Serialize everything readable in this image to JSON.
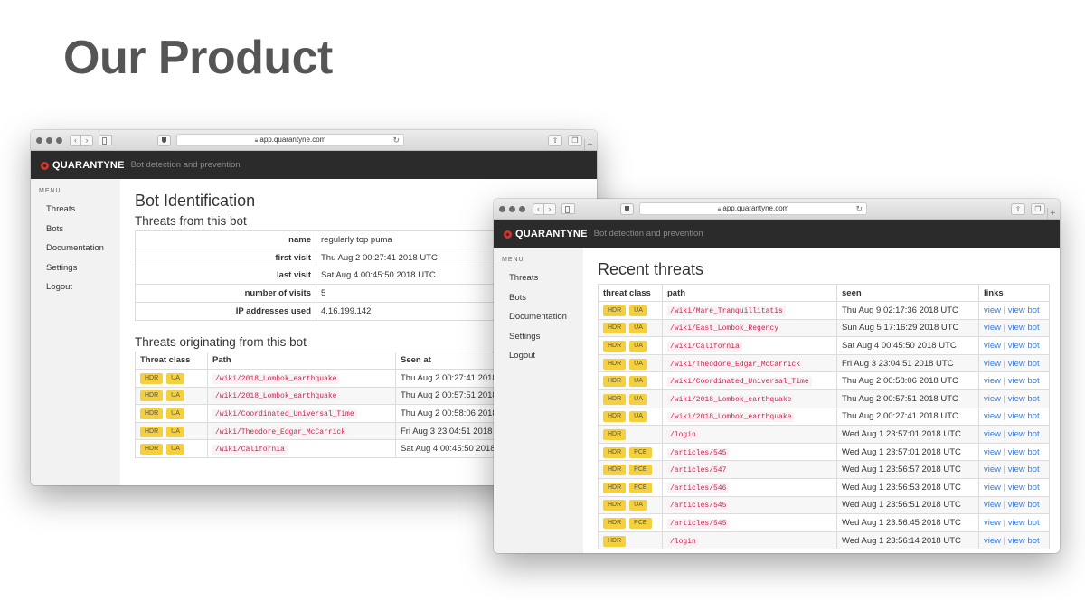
{
  "slide": {
    "title": "Our Product"
  },
  "browser": {
    "url": "app.quarantyne.com",
    "new_tab_symbol": "+"
  },
  "app": {
    "brand": "QUARANTYNE",
    "tagline": "Bot detection and prevention"
  },
  "menu": {
    "heading": "MENU",
    "items": [
      "Threats",
      "Bots",
      "Documentation",
      "Settings",
      "Logout"
    ]
  },
  "bot_page": {
    "title": "Bot Identification",
    "subtitle": "Threats from this bot",
    "fields": [
      {
        "label": "name",
        "value": "regularly top puma"
      },
      {
        "label": "first visit",
        "value": "Thu Aug 2 00:27:41 2018 UTC"
      },
      {
        "label": "last visit",
        "value": "Sat Aug 4 00:45:50 2018 UTC"
      },
      {
        "label": "number of visits",
        "value": "5"
      },
      {
        "label": "IP addresses used",
        "value": "4.16.199.142"
      }
    ],
    "threats_title": "Threats originating from this bot",
    "columns": [
      "Threat class",
      "Path",
      "Seen at"
    ],
    "rows": [
      {
        "badges": [
          "HDR",
          "UA"
        ],
        "path": "/wiki/2018_Lombok_earthquake",
        "seen": "Thu Aug 2 00:27:41 2018 UTC"
      },
      {
        "badges": [
          "HDR",
          "UA"
        ],
        "path": "/wiki/2018_Lombok_earthquake",
        "seen": "Thu Aug 2 00:57:51 2018 UTC"
      },
      {
        "badges": [
          "HDR",
          "UA"
        ],
        "path": "/wiki/Coordinated_Universal_Time",
        "seen": "Thu Aug 2 00:58:06 2018 UTC"
      },
      {
        "badges": [
          "HDR",
          "UA"
        ],
        "path": "/wiki/Theodore_Edgar_McCarrick",
        "seen": "Fri Aug 3 23:04:51 2018 UTC"
      },
      {
        "badges": [
          "HDR",
          "UA"
        ],
        "path": "/wiki/California",
        "seen": "Sat Aug 4 00:45:50 2018 UTC"
      }
    ]
  },
  "recent_page": {
    "title": "Recent threats",
    "columns": [
      "threat class",
      "path",
      "seen",
      "links"
    ],
    "link_view": "view",
    "link_sep": "|",
    "link_view_bot": "view bot",
    "rows": [
      {
        "badges": [
          "HDR",
          "UA"
        ],
        "path": "/wiki/Mare_Tranquillitatis",
        "seen": "Thu Aug 9 02:17:36 2018 UTC"
      },
      {
        "badges": [
          "HDR",
          "UA"
        ],
        "path": "/wiki/East_Lombok_Regency",
        "seen": "Sun Aug 5 17:16:29 2018 UTC"
      },
      {
        "badges": [
          "HDR",
          "UA"
        ],
        "path": "/wiki/California",
        "seen": "Sat Aug 4 00:45:50 2018 UTC"
      },
      {
        "badges": [
          "HDR",
          "UA"
        ],
        "path": "/wiki/Theodore_Edgar_McCarrick",
        "seen": "Fri Aug 3 23:04:51 2018 UTC"
      },
      {
        "badges": [
          "HDR",
          "UA"
        ],
        "path": "/wiki/Coordinated_Universal_Time",
        "seen": "Thu Aug 2 00:58:06 2018 UTC"
      },
      {
        "badges": [
          "HDR",
          "UA"
        ],
        "path": "/wiki/2018_Lombok_earthquake",
        "seen": "Thu Aug 2 00:57:51 2018 UTC"
      },
      {
        "badges": [
          "HDR",
          "UA"
        ],
        "path": "/wiki/2018_Lombok_earthquake",
        "seen": "Thu Aug 2 00:27:41 2018 UTC"
      },
      {
        "badges": [
          "HDR"
        ],
        "path": "/login",
        "seen": "Wed Aug 1 23:57:01 2018 UTC"
      },
      {
        "badges": [
          "HDR",
          "PCE"
        ],
        "path": "/articles/545",
        "seen": "Wed Aug 1 23:57:01 2018 UTC"
      },
      {
        "badges": [
          "HDR",
          "PCE"
        ],
        "path": "/articles/547",
        "seen": "Wed Aug 1 23:56:57 2018 UTC"
      },
      {
        "badges": [
          "HDR",
          "PCE"
        ],
        "path": "/articles/546",
        "seen": "Wed Aug 1 23:56:53 2018 UTC"
      },
      {
        "badges": [
          "HDR",
          "UA"
        ],
        "path": "/articles/545",
        "seen": "Wed Aug 1 23:56:51 2018 UTC"
      },
      {
        "badges": [
          "HDR",
          "PCE"
        ],
        "path": "/articles/545",
        "seen": "Wed Aug 1 23:56:45 2018 UTC"
      },
      {
        "badges": [
          "HDR"
        ],
        "path": "/login",
        "seen": "Wed Aug 1 23:56:14 2018 UTC"
      }
    ]
  },
  "colors": {
    "badge": "#f4d03f",
    "path_text": "#c7254e",
    "link": "#3b7ddd",
    "appbar": "#2b2b2b",
    "logo": "#d9342b"
  },
  "icons": [
    "back-icon",
    "forward-icon",
    "sidebar-icon",
    "shield-icon",
    "lock-icon",
    "reload-icon",
    "share-icon",
    "tabs-icon",
    "logo-icon"
  ]
}
